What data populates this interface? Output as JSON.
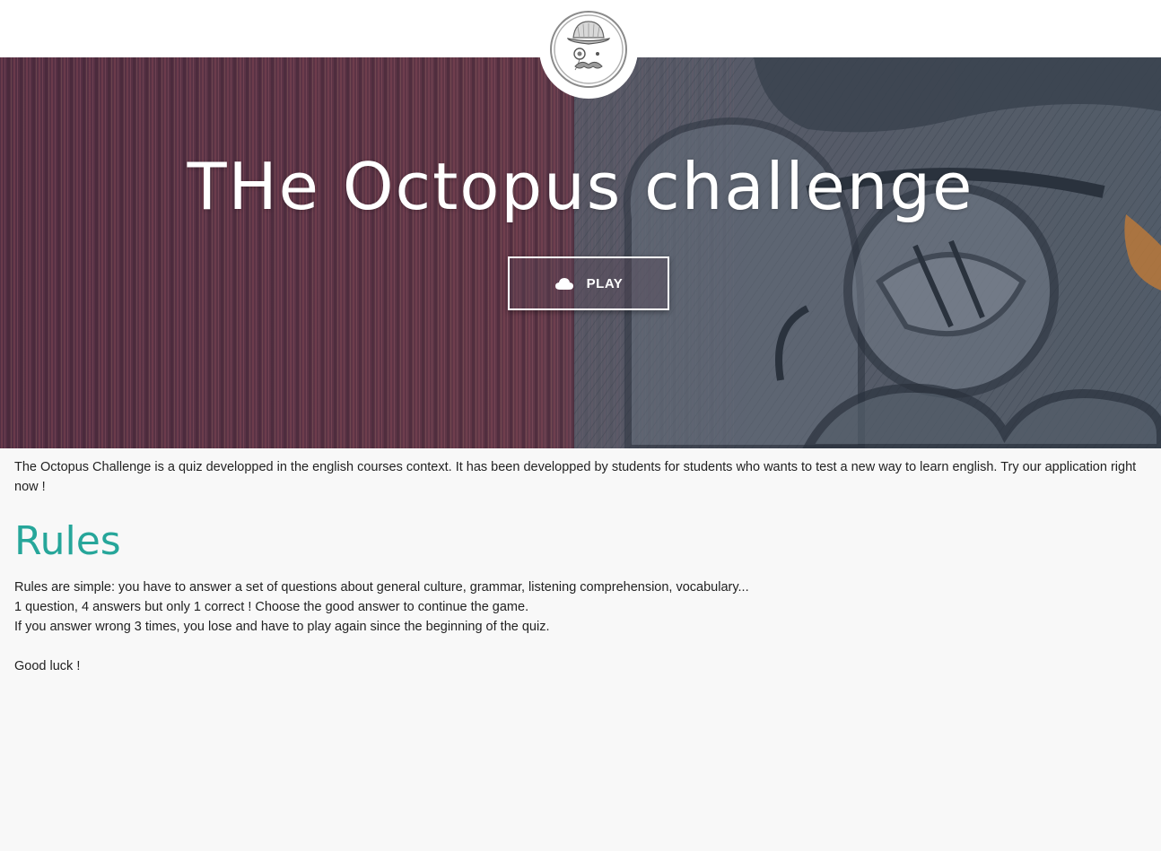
{
  "header": {
    "logo_icon": "octopus-gentleman-logo-icon"
  },
  "hero": {
    "title": "THe Octopus challenge",
    "play_button": {
      "icon": "cloud-icon",
      "label": "PLAY"
    },
    "background_icon": "octopus-face-illustration"
  },
  "main": {
    "intro": "The Octopus Challenge is a quiz developped in the english courses context. It has been developped by students for students who wants to test a new way to learn english. Try our application right now !",
    "rules_heading": "Rules",
    "rules_lines": [
      "Rules are simple: you have to answer a set of questions about general culture, grammar, listening comprehension, vocabulary...",
      "1 question, 4 answers but only 1 correct ! Choose the good answer to continue the game.",
      "If you answer wrong 3 times, you lose and have to play again since the beginning of the quiz."
    ],
    "closing": "Good luck !"
  },
  "colors": {
    "accent": "#26a69a",
    "topbar": "#ffffff",
    "page_background": "#f8f8f8"
  }
}
